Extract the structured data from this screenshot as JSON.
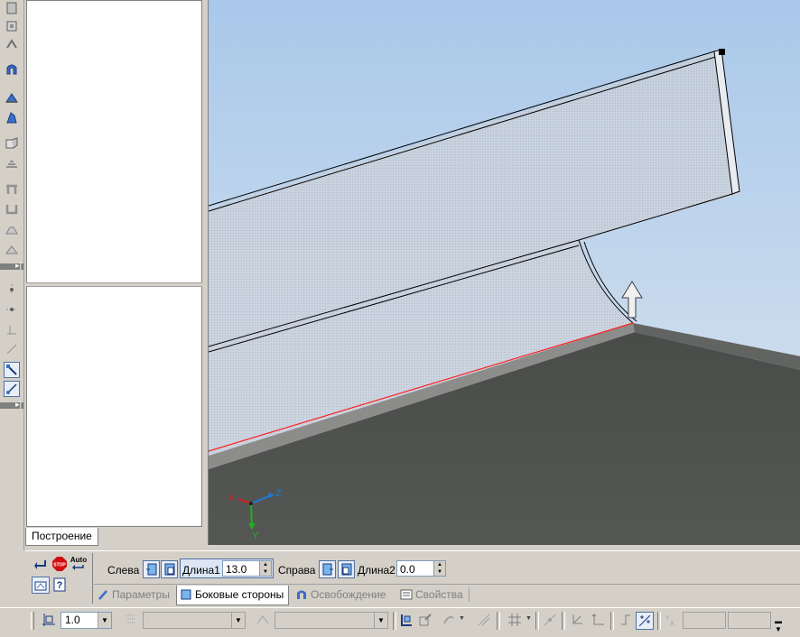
{
  "tree_tab": {
    "label": "Построение"
  },
  "property_panel": {
    "left_label": "Слева",
    "length1_label": "Длина1",
    "length1_value": "13.0",
    "right_label": "Справа",
    "length2_label": "Длина2",
    "length2_value": "0.0",
    "auto_label": "Auto",
    "stop_label": "STOP",
    "tabs": [
      {
        "label": "Параметры",
        "active": false
      },
      {
        "label": "Боковые стороны",
        "active": true
      },
      {
        "label": "Освобождение",
        "active": false
      },
      {
        "label": "Свойства",
        "active": false
      }
    ]
  },
  "bottom_toolbar": {
    "step_value": "1.0"
  },
  "viewport": {
    "axes": {
      "x": "X",
      "y": "Y",
      "z": "Z"
    },
    "colors": {
      "sky_top": "#c5d8ec",
      "sky_bottom": "#a8c6e6",
      "plate": "#4f514f",
      "edge": "#ff2020"
    }
  },
  "left_toolbar": {
    "icons": [
      "base-plate-icon",
      "sheet-metal-icon",
      "bend-icon",
      "flange-icon",
      "rib-icon",
      "stamp-icon",
      "unfold-icon",
      "refold-icon",
      "closed-corner-icon",
      "open-corner-icon",
      "hem-icon",
      "louver-icon",
      "point-icon",
      "line-icon",
      "axis-icon",
      "plane-icon",
      "edge-select-icon",
      "vertex-select-icon"
    ]
  }
}
